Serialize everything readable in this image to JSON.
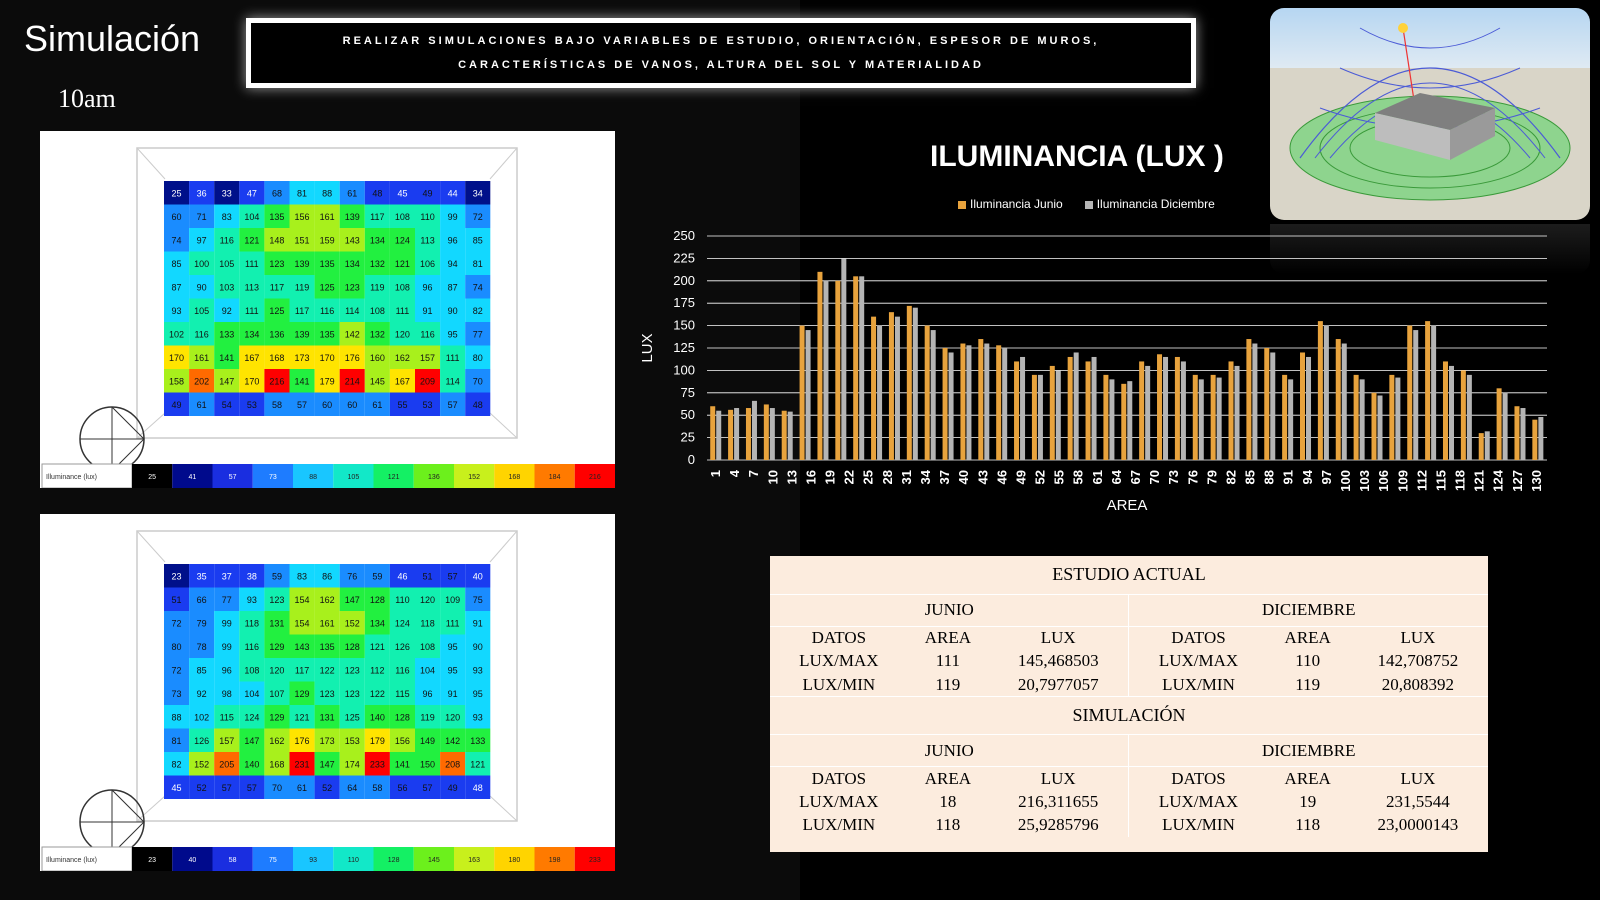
{
  "page": {
    "title": "Simulación",
    "time_label": "10am",
    "banner_text": "REALIZAR SIMULACIONES BAJO VARIABLES DE ESTUDIO, ORIENTACIÓN, ESPESOR DE MUROS, CARACTERÍSTICAS DE VANOS, ALTURA DEL SOL Y MATERIALIDAD"
  },
  "heatmaps": [
    {
      "legend_label": "Illuminance (lux)",
      "scale": [
        "25",
        "41",
        "57",
        "73",
        "88",
        "105",
        "121",
        "136",
        "152",
        "168",
        "184",
        "216"
      ],
      "min": 25,
      "max": 216,
      "rows": [
        [
          25,
          36,
          33,
          47,
          68,
          81,
          88,
          61,
          48,
          45,
          49,
          44,
          34
        ],
        [
          60,
          71,
          83,
          104,
          135,
          156,
          161,
          139,
          117,
          108,
          110,
          99,
          72
        ],
        [
          74,
          97,
          116,
          121,
          148,
          151,
          159,
          143,
          134,
          124,
          113,
          96,
          85
        ],
        [
          85,
          100,
          105,
          111,
          123,
          139,
          135,
          134,
          132,
          121,
          106,
          94,
          81
        ],
        [
          87,
          90,
          103,
          113,
          117,
          119,
          125,
          123,
          119,
          108,
          96,
          87,
          74
        ],
        [
          93,
          105,
          92,
          111,
          125,
          117,
          116,
          114,
          108,
          111,
          91,
          90,
          82
        ],
        [
          102,
          116,
          133,
          134,
          136,
          139,
          135,
          142,
          132,
          120,
          116,
          95,
          77
        ],
        [
          170,
          161,
          141,
          167,
          168,
          173,
          170,
          176,
          160,
          162,
          157,
          111,
          80
        ],
        [
          158,
          202,
          147,
          170,
          216,
          141,
          179,
          214,
          145,
          167,
          209,
          114,
          70
        ],
        [
          49,
          61,
          54,
          53,
          58,
          57,
          60,
          60,
          61,
          55,
          53,
          57,
          48
        ]
      ]
    },
    {
      "legend_label": "Illuminance (lux)",
      "scale": [
        "23",
        "40",
        "58",
        "75",
        "93",
        "110",
        "128",
        "145",
        "163",
        "180",
        "198",
        "233"
      ],
      "min": 23,
      "max": 233,
      "rows": [
        [
          23,
          35,
          37,
          38,
          59,
          83,
          86,
          76,
          59,
          46,
          51,
          57,
          40
        ],
        [
          51,
          66,
          77,
          93,
          123,
          154,
          162,
          147,
          128,
          110,
          120,
          109,
          75
        ],
        [
          72,
          79,
          99,
          118,
          131,
          154,
          161,
          152,
          134,
          124,
          118,
          111,
          91
        ],
        [
          80,
          78,
          99,
          116,
          129,
          143,
          135,
          128,
          121,
          126,
          108,
          95,
          90
        ],
        [
          72,
          85,
          96,
          108,
          120,
          117,
          122,
          123,
          112,
          116,
          104,
          95,
          93
        ],
        [
          73,
          92,
          98,
          104,
          107,
          129,
          123,
          123,
          122,
          115,
          96,
          91,
          95
        ],
        [
          88,
          102,
          115,
          124,
          129,
          121,
          131,
          125,
          140,
          128,
          119,
          120,
          93
        ],
        [
          81,
          126,
          157,
          147,
          162,
          176,
          173,
          153,
          179,
          156,
          149,
          142,
          133
        ],
        [
          82,
          152,
          205,
          140,
          168,
          231,
          147,
          174,
          233,
          141,
          150,
          208,
          121
        ],
        [
          45,
          52,
          57,
          57,
          70,
          61,
          52,
          64,
          58,
          56,
          57,
          49,
          48
        ]
      ]
    }
  ],
  "chart_data": {
    "type": "bar",
    "title": "ILUMINANCIA (LUX )",
    "xlabel": "AREA",
    "ylabel": "LUX",
    "ylim": [
      0,
      250
    ],
    "yticks": [
      "0",
      "25",
      "50",
      "75",
      "100",
      "125",
      "150",
      "175",
      "200",
      "225",
      "250"
    ],
    "categories": [
      "1",
      "4",
      "7",
      "10",
      "13",
      "16",
      "19",
      "22",
      "25",
      "28",
      "31",
      "34",
      "37",
      "40",
      "43",
      "46",
      "49",
      "52",
      "55",
      "58",
      "61",
      "64",
      "67",
      "70",
      "73",
      "76",
      "79",
      "82",
      "85",
      "88",
      "91",
      "94",
      "97",
      "100",
      "103",
      "106",
      "109",
      "112",
      "115",
      "118",
      "121",
      "124",
      "127",
      "130"
    ],
    "series": [
      {
        "name": "Iluminancia Junio",
        "color": "#e8a33d",
        "values": [
          60,
          56,
          58,
          62,
          55,
          150,
          210,
          200,
          205,
          160,
          165,
          172,
          150,
          125,
          130,
          135,
          128,
          110,
          95,
          105,
          115,
          110,
          95,
          85,
          110,
          118,
          115,
          95,
          95,
          110,
          135,
          125,
          95,
          120,
          155,
          135,
          95,
          75,
          95,
          150,
          155,
          110,
          100,
          30,
          80,
          60,
          45
        ]
      },
      {
        "name": "Iluminancia Diciembre",
        "color": "#b5b5b5",
        "values": [
          55,
          58,
          66,
          58,
          54,
          145,
          200,
          225,
          205,
          150,
          160,
          170,
          145,
          120,
          128,
          130,
          125,
          115,
          95,
          100,
          120,
          115,
          90,
          88,
          105,
          115,
          110,
          90,
          92,
          105,
          130,
          120,
          90,
          115,
          150,
          130,
          90,
          72,
          92,
          145,
          150,
          105,
          95,
          32,
          75,
          58,
          48
        ]
      }
    ],
    "legend_position": "top",
    "grid": true
  },
  "table": {
    "title_actual": "ESTUDIO ACTUAL",
    "title_sim": "SIMULACIÓN",
    "month_junio": "JUNIO",
    "month_diciembre": "DICIEMBRE",
    "col_datos": "DATOS",
    "col_area": "AREA",
    "col_lux": "LUX",
    "actual": {
      "max": {
        "label": "LUX/MAX",
        "j_area": "111",
        "j_lux": "145,468503",
        "d_area": "110",
        "d_lux": "142,708752"
      },
      "min": {
        "label": "LUX/MIN",
        "j_area": "119",
        "j_lux": "20,7977057",
        "d_area": "119",
        "d_lux": "20,808392"
      }
    },
    "sim": {
      "max": {
        "label": "LUX/MAX",
        "j_area": "18",
        "j_lux": "216,311655",
        "d_area": "19",
        "d_lux": "231,5544"
      },
      "min": {
        "label": "LUX/MIN",
        "j_area": "118",
        "j_lux": "25,9285796",
        "d_area": "118",
        "d_lux": "23,0000143"
      }
    }
  }
}
